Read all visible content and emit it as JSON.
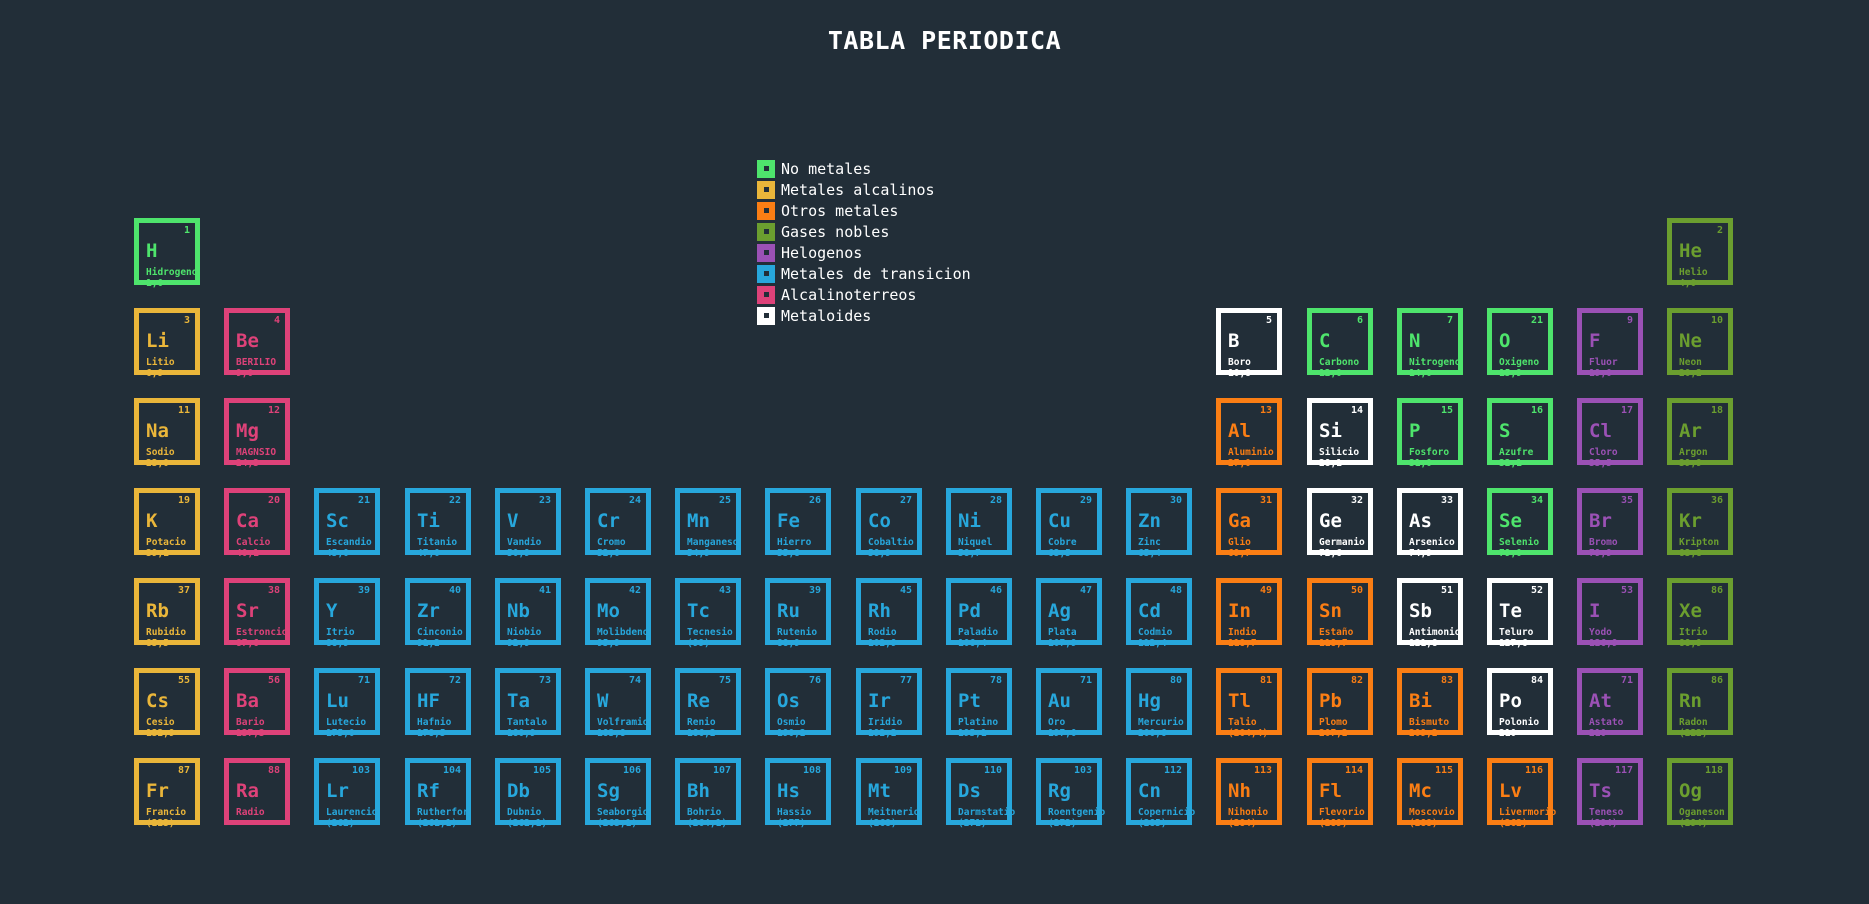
{
  "title": "TABLA PERIODICA",
  "colors": {
    "background": "#222e38",
    "nometal": "#4ee46c",
    "alcalino": "#eab63a",
    "otros": "#fb7e14",
    "noble": "#6b9e2f",
    "halogeno": "#9b51b5",
    "transicion": "#27a7dc",
    "alcalinoterreo": "#de4279",
    "metaloide": "#ffffff"
  },
  "legend": [
    {
      "type": "nometal",
      "label": "No metales"
    },
    {
      "type": "alcalino",
      "label": "Metales alcalinos"
    },
    {
      "type": "otros",
      "label": "Otros metales"
    },
    {
      "type": "noble",
      "label": "Gases nobles"
    },
    {
      "type": "halogeno",
      "label": "Helogenos"
    },
    {
      "type": "transicion",
      "label": "Metales de transicion"
    },
    {
      "type": "alcalinoterreo",
      "label": "Alcalinoterreos"
    },
    {
      "type": "metaloide",
      "label": "Metaloides"
    }
  ],
  "elements": [
    {
      "row": 1,
      "col": 1,
      "num": "1",
      "sym": "H",
      "name": "Hidrogeno",
      "mass": "1,0",
      "type": "nometal"
    },
    {
      "row": 1,
      "col": 18,
      "num": "2",
      "sym": "He",
      "name": "Helio",
      "mass": "4,0",
      "type": "noble"
    },
    {
      "row": 2,
      "col": 1,
      "num": "3",
      "sym": "Li",
      "name": "Litio",
      "mass": "6,9",
      "type": "alcalino"
    },
    {
      "row": 2,
      "col": 2,
      "num": "4",
      "sym": "Be",
      "name": "BERILIO",
      "mass": "9,0",
      "type": "alcalinoterreo"
    },
    {
      "row": 2,
      "col": 13,
      "num": "5",
      "sym": "B",
      "name": "Boro",
      "mass": "10,8",
      "type": "metaloide"
    },
    {
      "row": 2,
      "col": 14,
      "num": "6",
      "sym": "C",
      "name": "Carbono",
      "mass": "12,0",
      "type": "nometal"
    },
    {
      "row": 2,
      "col": 15,
      "num": "7",
      "sym": "N",
      "name": "Nitrogeno",
      "mass": "14,0",
      "type": "nometal"
    },
    {
      "row": 2,
      "col": 16,
      "num": "21",
      "sym": "O",
      "name": "Oxigeno",
      "mass": "15,9",
      "type": "nometal"
    },
    {
      "row": 2,
      "col": 17,
      "num": "9",
      "sym": "F",
      "name": "Fluor",
      "mass": "19,0",
      "type": "halogeno"
    },
    {
      "row": 2,
      "col": 18,
      "num": "10",
      "sym": "Ne",
      "name": "Neon",
      "mass": "20,2",
      "type": "noble"
    },
    {
      "row": 3,
      "col": 1,
      "num": "11",
      "sym": "Na",
      "name": "Sodio",
      "mass": "23,0",
      "type": "alcalino"
    },
    {
      "row": 3,
      "col": 2,
      "num": "12",
      "sym": "Mg",
      "name": "MAGNSIO",
      "mass": "24,3",
      "type": "alcalinoterreo"
    },
    {
      "row": 3,
      "col": 13,
      "num": "13",
      "sym": "Al",
      "name": "Aluminio",
      "mass": "27,0",
      "type": "otros"
    },
    {
      "row": 3,
      "col": 14,
      "num": "14",
      "sym": "Si",
      "name": "Silicio",
      "mass": "28,1",
      "type": "metaloide"
    },
    {
      "row": 3,
      "col": 15,
      "num": "15",
      "sym": "P",
      "name": "Fosforo",
      "mass": "31,0",
      "type": "nometal"
    },
    {
      "row": 3,
      "col": 16,
      "num": "16",
      "sym": "S",
      "name": "Azufre",
      "mass": "32,1",
      "type": "nometal"
    },
    {
      "row": 3,
      "col": 17,
      "num": "17",
      "sym": "Cl",
      "name": "Cloro",
      "mass": "35,5",
      "type": "halogeno"
    },
    {
      "row": 3,
      "col": 18,
      "num": "18",
      "sym": "Ar",
      "name": "Argon",
      "mass": "39,9",
      "type": "noble"
    },
    {
      "row": 4,
      "col": 1,
      "num": "19",
      "sym": "K",
      "name": "Potacio",
      "mass": "39,1",
      "type": "alcalino"
    },
    {
      "row": 4,
      "col": 2,
      "num": "20",
      "sym": "Ca",
      "name": "Calcio",
      "mass": "40,1",
      "type": "alcalinoterreo"
    },
    {
      "row": 4,
      "col": 3,
      "num": "21",
      "sym": "Sc",
      "name": "Escandio",
      "mass": "45,0",
      "type": "transicion"
    },
    {
      "row": 4,
      "col": 4,
      "num": "22",
      "sym": "Ti",
      "name": "Titanio",
      "mass": "47,0",
      "type": "transicion"
    },
    {
      "row": 4,
      "col": 5,
      "num": "23",
      "sym": "V",
      "name": "Vandio",
      "mass": "50,9",
      "type": "transicion"
    },
    {
      "row": 4,
      "col": 6,
      "num": "24",
      "sym": "Cr",
      "name": "Cromo",
      "mass": "52,0",
      "type": "transicion"
    },
    {
      "row": 4,
      "col": 7,
      "num": "25",
      "sym": "Mn",
      "name": "Manganeso",
      "mass": "54,9",
      "type": "transicion"
    },
    {
      "row": 4,
      "col": 8,
      "num": "26",
      "sym": "Fe",
      "name": "Hierro",
      "mass": "55,8",
      "type": "transicion"
    },
    {
      "row": 4,
      "col": 9,
      "num": "27",
      "sym": "Co",
      "name": "Cobaltio",
      "mass": "58,9",
      "type": "transicion"
    },
    {
      "row": 4,
      "col": 10,
      "num": "28",
      "sym": "Ni",
      "name": "Niquel",
      "mass": "58,7",
      "type": "transicion"
    },
    {
      "row": 4,
      "col": 11,
      "num": "29",
      "sym": "Cu",
      "name": "Cobre",
      "mass": "63,5",
      "type": "transicion"
    },
    {
      "row": 4,
      "col": 12,
      "num": "30",
      "sym": "Zn",
      "name": "Zinc",
      "mass": "65,4",
      "type": "transicion"
    },
    {
      "row": 4,
      "col": 13,
      "num": "31",
      "sym": "Ga",
      "name": "Glio",
      "mass": "69,7",
      "type": "otros"
    },
    {
      "row": 4,
      "col": 14,
      "num": "32",
      "sym": "Ge",
      "name": "Germanio",
      "mass": "72,6",
      "type": "metaloide"
    },
    {
      "row": 4,
      "col": 15,
      "num": "33",
      "sym": "As",
      "name": "Arsenico",
      "mass": "74,9",
      "type": "metaloide"
    },
    {
      "row": 4,
      "col": 16,
      "num": "34",
      "sym": "Se",
      "name": "Selenio",
      "mass": "79,0",
      "type": "nometal"
    },
    {
      "row": 4,
      "col": 17,
      "num": "35",
      "sym": "Br",
      "name": "Bromo",
      "mass": "79,9",
      "type": "halogeno"
    },
    {
      "row": 4,
      "col": 18,
      "num": "36",
      "sym": "Kr",
      "name": "Kripton",
      "mass": "83,8",
      "type": "noble"
    },
    {
      "row": 5,
      "col": 1,
      "num": "37",
      "sym": "Rb",
      "name": "Rubidio",
      "mass": "85,5",
      "type": "alcalino"
    },
    {
      "row": 5,
      "col": 2,
      "num": "38",
      "sym": "Sr",
      "name": "Estroncio",
      "mass": "87,6",
      "type": "alcalinoterreo"
    },
    {
      "row": 5,
      "col": 3,
      "num": "39",
      "sym": "Y",
      "name": "Itrio",
      "mass": "88,9",
      "type": "transicion"
    },
    {
      "row": 5,
      "col": 4,
      "num": "40",
      "sym": "Zr",
      "name": "Cinconio",
      "mass": "91,2",
      "type": "transicion"
    },
    {
      "row": 5,
      "col": 5,
      "num": "41",
      "sym": "Nb",
      "name": "Niobio",
      "mass": "92,9",
      "type": "transicion"
    },
    {
      "row": 5,
      "col": 6,
      "num": "42",
      "sym": "Mo",
      "name": "Molibdeno",
      "mass": "95,9",
      "type": "transicion"
    },
    {
      "row": 5,
      "col": 7,
      "num": "43",
      "sym": "Tc",
      "name": "Tecnesio",
      "mass": "(99)",
      "type": "transicion"
    },
    {
      "row": 5,
      "col": 8,
      "num": "39",
      "sym": "Ru",
      "name": "Rutenio",
      "mass": "88,9",
      "type": "transicion"
    },
    {
      "row": 5,
      "col": 9,
      "num": "45",
      "sym": "Rh",
      "name": "Rodio",
      "mass": "102,9",
      "type": "transicion"
    },
    {
      "row": 5,
      "col": 10,
      "num": "46",
      "sym": "Pd",
      "name": "Paladio",
      "mass": "106,4",
      "type": "transicion"
    },
    {
      "row": 5,
      "col": 11,
      "num": "47",
      "sym": "Ag",
      "name": "Plata",
      "mass": "107,9",
      "type": "transicion"
    },
    {
      "row": 5,
      "col": 12,
      "num": "48",
      "sym": "Cd",
      "name": "Codmio",
      "mass": "112,4",
      "type": "transicion"
    },
    {
      "row": 5,
      "col": 13,
      "num": "49",
      "sym": "In",
      "name": "Indio",
      "mass": "118,7",
      "type": "otros"
    },
    {
      "row": 5,
      "col": 14,
      "num": "50",
      "sym": "Sn",
      "name": "Estaño",
      "mass": "118,7",
      "type": "otros"
    },
    {
      "row": 5,
      "col": 15,
      "num": "51",
      "sym": "Sb",
      "name": "Antimonio",
      "mass": "121,8",
      "type": "metaloide"
    },
    {
      "row": 5,
      "col": 16,
      "num": "52",
      "sym": "Te",
      "name": "Teluro",
      "mass": "127,6",
      "type": "metaloide"
    },
    {
      "row": 5,
      "col": 17,
      "num": "53",
      "sym": "I",
      "name": "Yodo",
      "mass": "126,9",
      "type": "halogeno"
    },
    {
      "row": 5,
      "col": 18,
      "num": "86",
      "sym": "Xe",
      "name": "Itrio",
      "mass": "88,9",
      "type": "noble"
    },
    {
      "row": 6,
      "col": 1,
      "num": "55",
      "sym": "Cs",
      "name": "Cesio",
      "mass": "132,9",
      "type": "alcalino"
    },
    {
      "row": 6,
      "col": 2,
      "num": "56",
      "sym": "Ba",
      "name": "Bario",
      "mass": "137,3",
      "type": "alcalinoterreo"
    },
    {
      "row": 6,
      "col": 3,
      "num": "71",
      "sym": "Lu",
      "name": "Lutecio",
      "mass": "175,0",
      "type": "transicion"
    },
    {
      "row": 6,
      "col": 4,
      "num": "72",
      "sym": "HF",
      "name": "Hafnio",
      "mass": "178,5",
      "type": "transicion"
    },
    {
      "row": 6,
      "col": 5,
      "num": "73",
      "sym": "Ta",
      "name": "Tantalo",
      "mass": "180,9",
      "type": "transicion"
    },
    {
      "row": 6,
      "col": 6,
      "num": "74",
      "sym": "W",
      "name": "Volframio",
      "mass": "183,8",
      "type": "transicion"
    },
    {
      "row": 6,
      "col": 7,
      "num": "75",
      "sym": "Re",
      "name": "Renio",
      "mass": "186,2",
      "type": "transicion"
    },
    {
      "row": 6,
      "col": 8,
      "num": "76",
      "sym": "Os",
      "name": "Osmio",
      "mass": "190,2",
      "type": "transicion"
    },
    {
      "row": 6,
      "col": 9,
      "num": "77",
      "sym": "Ir",
      "name": "Iridio",
      "mass": "192,2",
      "type": "transicion"
    },
    {
      "row": 6,
      "col": 10,
      "num": "78",
      "sym": "Pt",
      "name": "Platino",
      "mass": "195,1",
      "type": "transicion"
    },
    {
      "row": 6,
      "col": 11,
      "num": "71",
      "sym": "Au",
      "name": "Oro",
      "mass": "197,0",
      "type": "transicion"
    },
    {
      "row": 6,
      "col": 12,
      "num": "80",
      "sym": "Hg",
      "name": "Mercurio",
      "mass": "200,6",
      "type": "transicion"
    },
    {
      "row": 6,
      "col": 13,
      "num": "81",
      "sym": "Tl",
      "name": "Talio",
      "mass": "(204,4)",
      "type": "otros"
    },
    {
      "row": 6,
      "col": 14,
      "num": "82",
      "sym": "Pb",
      "name": "Plomo",
      "mass": "207,2",
      "type": "otros"
    },
    {
      "row": 6,
      "col": 15,
      "num": "83",
      "sym": "Bi",
      "name": "Bismuto",
      "mass": "209,2",
      "type": "otros"
    },
    {
      "row": 6,
      "col": 16,
      "num": "84",
      "sym": "Po",
      "name": "Polonio",
      "mass": "210",
      "type": "metaloide"
    },
    {
      "row": 6,
      "col": 17,
      "num": "71",
      "sym": "At",
      "name": "Astato",
      "mass": "210",
      "type": "halogeno"
    },
    {
      "row": 6,
      "col": 18,
      "num": "86",
      "sym": "Rn",
      "name": "Radon",
      "mass": "(222)",
      "type": "noble"
    },
    {
      "row": 7,
      "col": 1,
      "num": "87",
      "sym": "Fr",
      "name": "Francio",
      "mass": "(223)",
      "type": "alcalino"
    },
    {
      "row": 7,
      "col": 2,
      "num": "88",
      "sym": "Ra",
      "name": "Radio",
      "mass": "",
      "type": "alcalinoterreo"
    },
    {
      "row": 7,
      "col": 3,
      "num": "103",
      "sym": "Lr",
      "name": "Laurencio",
      "mass": "(262)",
      "type": "transicion"
    },
    {
      "row": 7,
      "col": 4,
      "num": "104",
      "sym": "Rf",
      "name": "Rutherfor",
      "mass": "(261,1)",
      "type": "transicion"
    },
    {
      "row": 7,
      "col": 5,
      "num": "105",
      "sym": "Db",
      "name": "Dubnio",
      "mass": "(262,1)",
      "type": "transicion"
    },
    {
      "row": 7,
      "col": 6,
      "num": "106",
      "sym": "Sg",
      "name": "Seaborgio",
      "mass": "(263,1)",
      "type": "transicion"
    },
    {
      "row": 7,
      "col": 7,
      "num": "107",
      "sym": "Bh",
      "name": "Bohrio",
      "mass": "(264,1)",
      "type": "transicion"
    },
    {
      "row": 7,
      "col": 8,
      "num": "108",
      "sym": "Hs",
      "name": "Hassio",
      "mass": "(277)",
      "type": "transicion"
    },
    {
      "row": 7,
      "col": 9,
      "num": "109",
      "sym": "Mt",
      "name": "Meitnerio",
      "mass": "(268)",
      "type": "transicion"
    },
    {
      "row": 7,
      "col": 10,
      "num": "110",
      "sym": "Ds",
      "name": "Darmstatio",
      "mass": "(271)",
      "type": "transicion"
    },
    {
      "row": 7,
      "col": 11,
      "num": "103",
      "sym": "Rg",
      "name": "Roentgenio",
      "mass": "(272)",
      "type": "transicion"
    },
    {
      "row": 7,
      "col": 12,
      "num": "112",
      "sym": "Cn",
      "name": "Copernicio",
      "mass": "(285)",
      "type": "transicion"
    },
    {
      "row": 7,
      "col": 13,
      "num": "113",
      "sym": "Nh",
      "name": "Nihonio",
      "mass": "(284)",
      "type": "otros"
    },
    {
      "row": 7,
      "col": 14,
      "num": "114",
      "sym": "Fl",
      "name": "Flevorio",
      "mass": "(289)",
      "type": "otros"
    },
    {
      "row": 7,
      "col": 15,
      "num": "115",
      "sym": "Mc",
      "name": "Moscovio",
      "mass": "(288)",
      "type": "otros"
    },
    {
      "row": 7,
      "col": 16,
      "num": "116",
      "sym": "Lv",
      "name": "Livermorio",
      "mass": "(262)",
      "type": "otros"
    },
    {
      "row": 7,
      "col": 17,
      "num": "117",
      "sym": "Ts",
      "name": "Teneso",
      "mass": "(294)",
      "type": "halogeno"
    },
    {
      "row": 7,
      "col": 18,
      "num": "118",
      "sym": "Og",
      "name": "Oganeson",
      "mass": "(294)",
      "type": "noble"
    }
  ]
}
